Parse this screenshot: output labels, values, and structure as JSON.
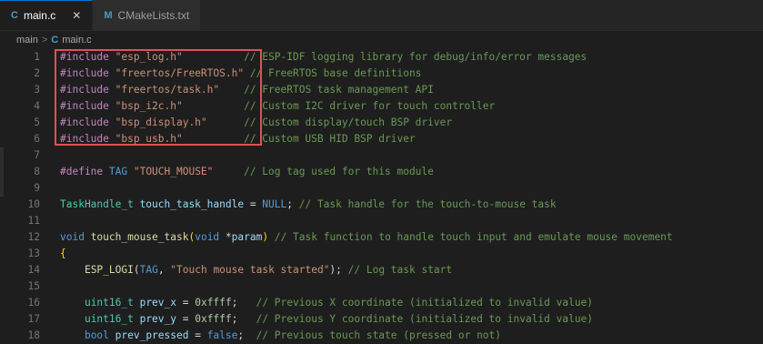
{
  "tabs": [
    {
      "icon": "C",
      "label": "main.c",
      "close": "✕",
      "active": true
    },
    {
      "icon": "M",
      "label": "CMakeLists.txt",
      "active": false
    }
  ],
  "breadcrumb": {
    "folder": "main",
    "sep": ">",
    "file_icon": "C",
    "file": "main.c"
  },
  "lines": [
    {
      "n": "1",
      "parts": [
        [
          "pre",
          "#include "
        ],
        [
          "str",
          "\"esp_log.h\""
        ],
        [
          "punc",
          "          "
        ],
        [
          "com",
          "// ESP-IDF logging library for debug/info/error messages"
        ]
      ]
    },
    {
      "n": "2",
      "parts": [
        [
          "pre",
          "#include "
        ],
        [
          "str",
          "\"freertos/FreeRTOS.h\""
        ],
        [
          "punc",
          " "
        ],
        [
          "com",
          "// FreeRTOS base definitions"
        ]
      ]
    },
    {
      "n": "3",
      "parts": [
        [
          "pre",
          "#include "
        ],
        [
          "str",
          "\"freertos/task.h\""
        ],
        [
          "punc",
          "    "
        ],
        [
          "com",
          "// FreeRTOS task management API"
        ]
      ]
    },
    {
      "n": "4",
      "parts": [
        [
          "pre",
          "#include "
        ],
        [
          "str",
          "\"bsp_i2c.h\""
        ],
        [
          "punc",
          "          "
        ],
        [
          "com",
          "// Custom I2C driver for touch controller"
        ]
      ]
    },
    {
      "n": "5",
      "parts": [
        [
          "pre",
          "#include "
        ],
        [
          "str",
          "\"bsp_display.h\""
        ],
        [
          "punc",
          "      "
        ],
        [
          "com",
          "// Custom display/touch BSP driver"
        ]
      ]
    },
    {
      "n": "6",
      "parts": [
        [
          "pre",
          "#include "
        ],
        [
          "str",
          "\"bsp_usb.h\""
        ],
        [
          "punc",
          "          "
        ],
        [
          "com",
          "// Custom USB HID BSP driver"
        ]
      ]
    },
    {
      "n": "7",
      "parts": []
    },
    {
      "n": "8",
      "parts": [
        [
          "pre",
          "#define "
        ],
        [
          "macro",
          "TAG "
        ],
        [
          "str",
          "\"TOUCH_MOUSE\""
        ],
        [
          "punc",
          "     "
        ],
        [
          "com",
          "// Log tag used for this module"
        ]
      ]
    },
    {
      "n": "9",
      "parts": []
    },
    {
      "n": "10",
      "parts": [
        [
          "type",
          "TaskHandle_t "
        ],
        [
          "var",
          "touch_task_handle"
        ],
        [
          "punc",
          " = "
        ],
        [
          "kw",
          "NULL"
        ],
        [
          "punc",
          "; "
        ],
        [
          "com",
          "// Task handle for the touch-to-mouse task"
        ]
      ]
    },
    {
      "n": "11",
      "parts": []
    },
    {
      "n": "12",
      "parts": [
        [
          "kw",
          "void "
        ],
        [
          "fn",
          "touch_mouse_task"
        ],
        [
          "brace",
          "("
        ],
        [
          "kw",
          "void "
        ],
        [
          "punc",
          "*"
        ],
        [
          "var",
          "param"
        ],
        [
          "brace",
          ")"
        ],
        [
          "punc",
          " "
        ],
        [
          "com",
          "// Task function to handle touch input and emulate mouse movement"
        ]
      ]
    },
    {
      "n": "13",
      "parts": [
        [
          "brace",
          "{"
        ]
      ]
    },
    {
      "n": "14",
      "parts": [
        [
          "punc",
          "    "
        ],
        [
          "fn",
          "ESP_LOGI"
        ],
        [
          "punc",
          "("
        ],
        [
          "macro",
          "TAG"
        ],
        [
          "punc",
          ", "
        ],
        [
          "str",
          "\"Touch mouse task started\""
        ],
        [
          "punc",
          "); "
        ],
        [
          "com",
          "// Log task start"
        ]
      ]
    },
    {
      "n": "15",
      "parts": []
    },
    {
      "n": "16",
      "parts": [
        [
          "punc",
          "    "
        ],
        [
          "type",
          "uint16_t "
        ],
        [
          "var",
          "prev_x"
        ],
        [
          "punc",
          " = "
        ],
        [
          "num",
          "0xffff"
        ],
        [
          "punc",
          ";   "
        ],
        [
          "com",
          "// Previous X coordinate (initialized to invalid value)"
        ]
      ]
    },
    {
      "n": "17",
      "parts": [
        [
          "punc",
          "    "
        ],
        [
          "type",
          "uint16_t "
        ],
        [
          "var",
          "prev_y"
        ],
        [
          "punc",
          " = "
        ],
        [
          "num",
          "0xffff"
        ],
        [
          "punc",
          ";   "
        ],
        [
          "com",
          "// Previous Y coordinate (initialized to invalid value)"
        ]
      ]
    },
    {
      "n": "18",
      "parts": [
        [
          "punc",
          "    "
        ],
        [
          "kw",
          "bool "
        ],
        [
          "var",
          "prev_pressed"
        ],
        [
          "punc",
          " = "
        ],
        [
          "kw",
          "false"
        ],
        [
          "punc",
          ";  "
        ],
        [
          "com",
          "// Previous touch state (pressed or not)"
        ]
      ]
    }
  ]
}
